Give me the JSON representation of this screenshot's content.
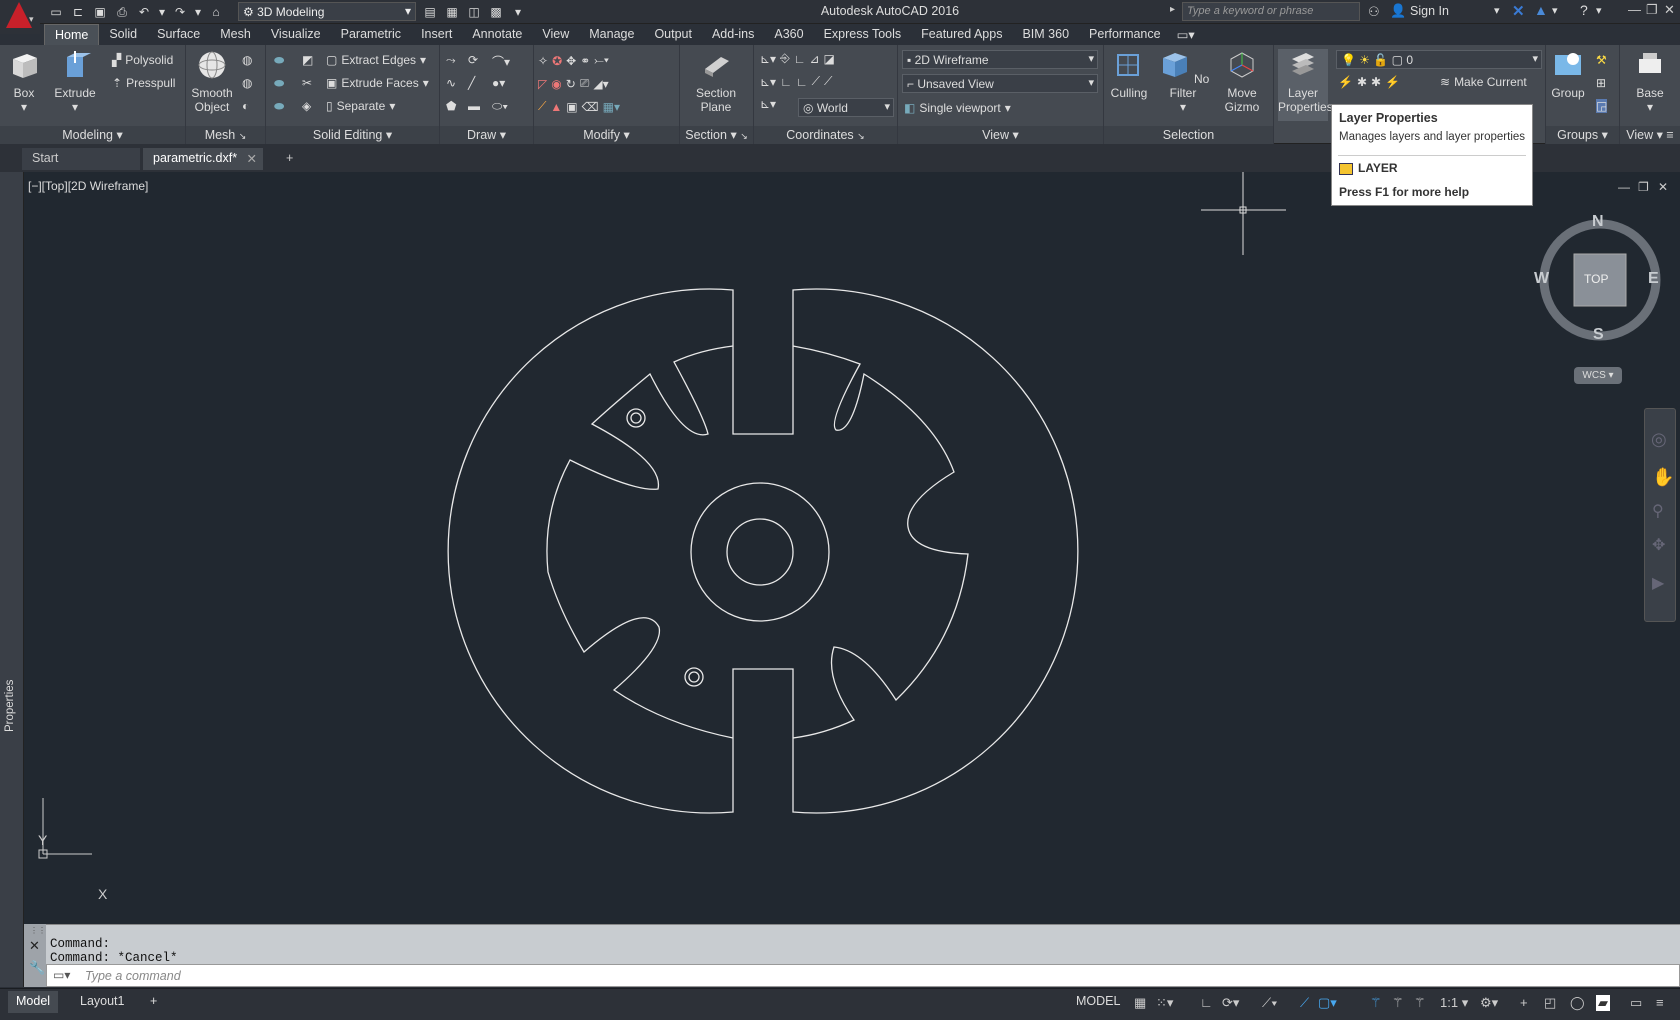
{
  "app": {
    "title": "Autodesk AutoCAD 2016",
    "workspace": "3D Modeling",
    "search_placeholder": "Type a keyword or phrase",
    "signin": "Sign In"
  },
  "ribbon_tabs": [
    "Home",
    "Solid",
    "Surface",
    "Mesh",
    "Visualize",
    "Parametric",
    "Insert",
    "Annotate",
    "View",
    "Manage",
    "Output",
    "Add-ins",
    "A360",
    "Express Tools",
    "Featured Apps",
    "BIM 360",
    "Performance"
  ],
  "ribbon": {
    "modeling": {
      "title": "Modeling",
      "box": "Box",
      "extrude": "Extrude",
      "polysolid": "Polysolid",
      "presspull": "Presspull"
    },
    "mesh": {
      "title": "Mesh",
      "smooth": "Smooth",
      "object": "Object"
    },
    "solid_editing": {
      "title": "Solid Editing",
      "extract_edges": "Extract Edges",
      "extrude_faces": "Extrude Faces",
      "separate": "Separate"
    },
    "draw": {
      "title": "Draw"
    },
    "modify": {
      "title": "Modify"
    },
    "section": {
      "title": "Section",
      "plane1": "Section",
      "plane2": "Plane"
    },
    "coordinates": {
      "title": "Coordinates",
      "world": "World"
    },
    "view": {
      "title": "View",
      "visual_style": "2D Wireframe",
      "named_view": "Unsaved View",
      "viewport": "Single viewport"
    },
    "selection": {
      "title": "Selection",
      "culling": "Culling",
      "nofilter": "No Filter",
      "gizmo1": "Move",
      "gizmo2": "Gizmo"
    },
    "layers": {
      "props1": "Layer",
      "props2": "Properties",
      "layer_value": "0",
      "make_current": "Make Current"
    },
    "groups": {
      "title": "Groups",
      "group": "Group"
    },
    "viewpanel": {
      "title": "View",
      "base": "Base"
    }
  },
  "tooltip": {
    "title": "Layer Properties",
    "desc": "Manages layers and layer properties",
    "command": "LAYER",
    "help": "Press F1 for more help"
  },
  "file_tabs": {
    "start": "Start",
    "file": "parametric.dxf*"
  },
  "viewport_label": "[−][Top][2D Wireframe]",
  "viewcube": {
    "n": "N",
    "s": "S",
    "e": "E",
    "w": "W",
    "face": "TOP",
    "wcs": "WCS"
  },
  "ucs": {
    "x": "X",
    "y": "Y"
  },
  "side_panel": "Properties",
  "command": {
    "history": [
      "Command:",
      "Command: *Cancel*"
    ],
    "placeholder": "Type a command"
  },
  "status": {
    "model_tab": "Model",
    "layout_tab": "Layout1",
    "model": "MODEL",
    "scale": "1:1"
  },
  "colors": {
    "canvas": "#212830",
    "ribbon": "#454a51",
    "accent": "#c8202a"
  }
}
